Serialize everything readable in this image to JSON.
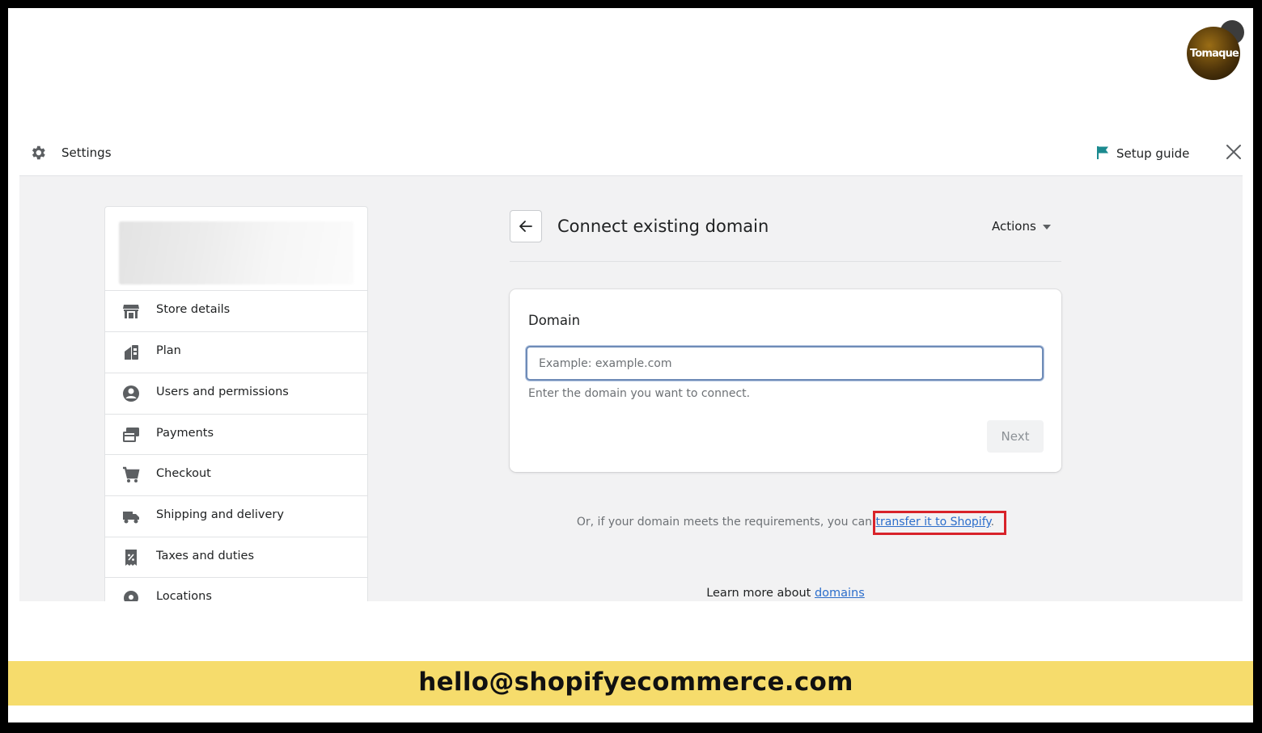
{
  "brand": {
    "logo_text": "Tomaque"
  },
  "topbar": {
    "title": "Settings",
    "setup_guide": "Setup guide"
  },
  "sidebar": {
    "items": [
      {
        "label": "Store details",
        "icon": "store-icon"
      },
      {
        "label": "Plan",
        "icon": "plan-icon"
      },
      {
        "label": "Users and permissions",
        "icon": "user-icon"
      },
      {
        "label": "Payments",
        "icon": "payments-icon"
      },
      {
        "label": "Checkout",
        "icon": "cart-icon"
      },
      {
        "label": "Shipping and delivery",
        "icon": "truck-icon"
      },
      {
        "label": "Taxes and duties",
        "icon": "tax-receipt-icon"
      },
      {
        "label": "Locations",
        "icon": "location-icon"
      }
    ]
  },
  "page": {
    "title": "Connect existing domain",
    "actions_label": "Actions"
  },
  "domain_card": {
    "heading": "Domain",
    "placeholder": "Example: example.com",
    "help_text": "Enter the domain you want to connect.",
    "next_label": "Next"
  },
  "transfer": {
    "prefix": "Or, if your domain meets the requirements, you can ",
    "link": "transfer it to Shopify",
    "suffix": "."
  },
  "learn_more": {
    "prefix": "Learn more about ",
    "link": "domains"
  },
  "contact": {
    "email": "hello@shopifyecommerce.com"
  },
  "colors": {
    "highlight": "#d8232a",
    "link": "#2c6ecb",
    "banner": "#f6dc6c",
    "flag": "#1b8a8f"
  }
}
